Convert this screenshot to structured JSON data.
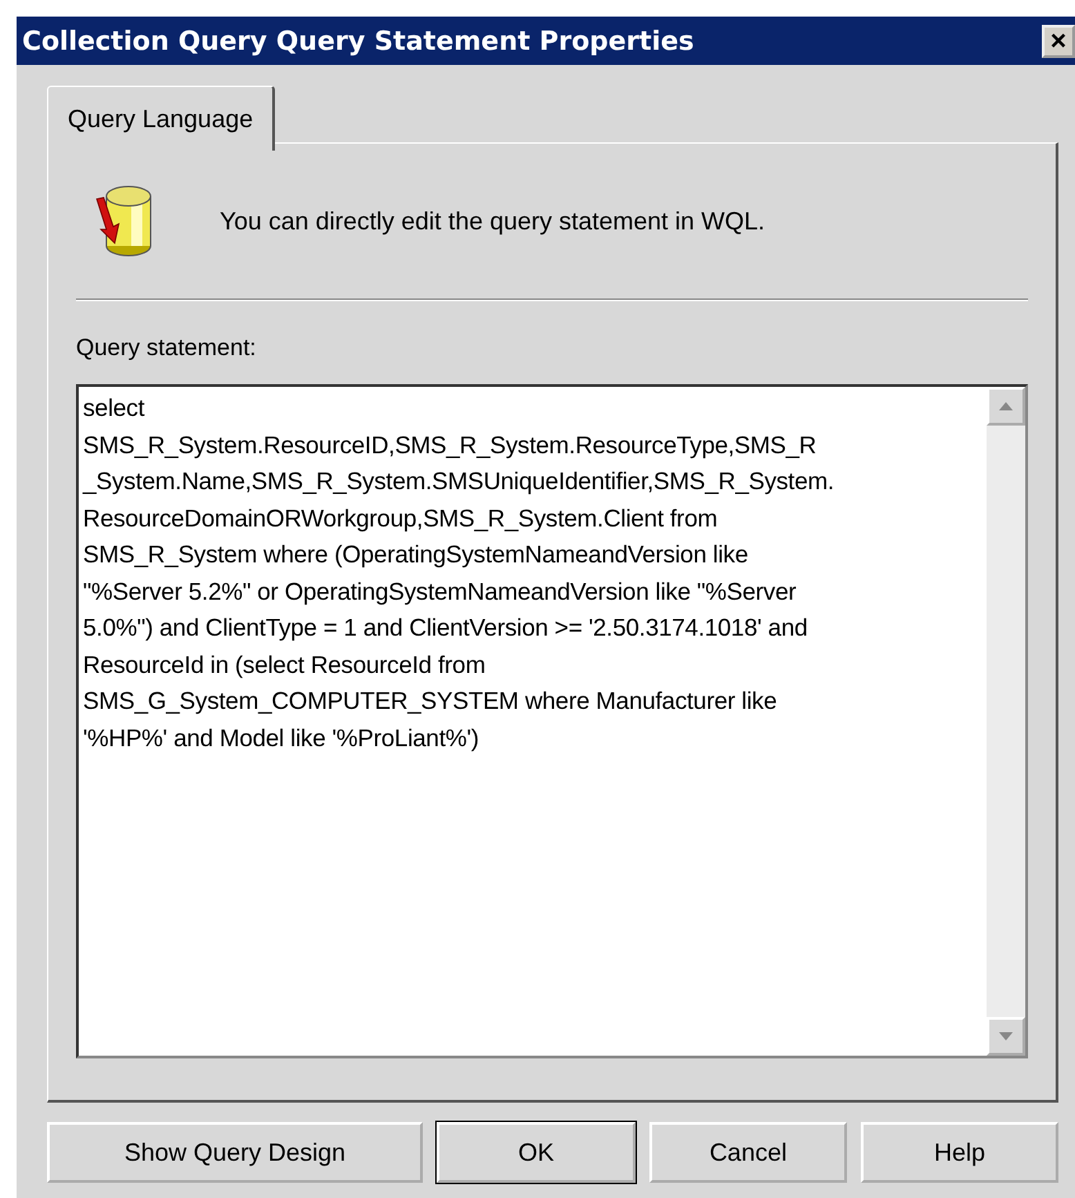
{
  "window": {
    "title": "Collection Query Query Statement Properties",
    "close": "×"
  },
  "tabs": [
    {
      "label": "Query Language",
      "selected": true
    }
  ],
  "info": "You can directly edit the query statement in WQL.",
  "query": {
    "label": "Query statement:",
    "lines": [
      "select",
      "SMS_R_System.ResourceID,SMS_R_System.ResourceType,SMS_R",
      "_System.Name,SMS_R_System.SMSUniqueIdentifier,SMS_R_System.",
      "ResourceDomainORWorkgroup,SMS_R_System.Client from",
      "SMS_R_System where (OperatingSystemNameandVersion like",
      "\"%Server 5.2%\" or OperatingSystemNameandVersion like \"%Server",
      "5.0%\") and ClientType = 1 and ClientVersion >= '2.50.3174.1018' and",
      "ResourceId in (select ResourceId from",
      "SMS_G_System_COMPUTER_SYSTEM where Manufacturer like",
      "'%HP%' and Model like '%ProLiant%')"
    ]
  },
  "buttons": [
    {
      "label": "Show Query Design",
      "default": false
    },
    {
      "label": "OK",
      "default": true
    },
    {
      "label": "Cancel",
      "default": false
    },
    {
      "label": "Help",
      "default": false
    }
  ]
}
